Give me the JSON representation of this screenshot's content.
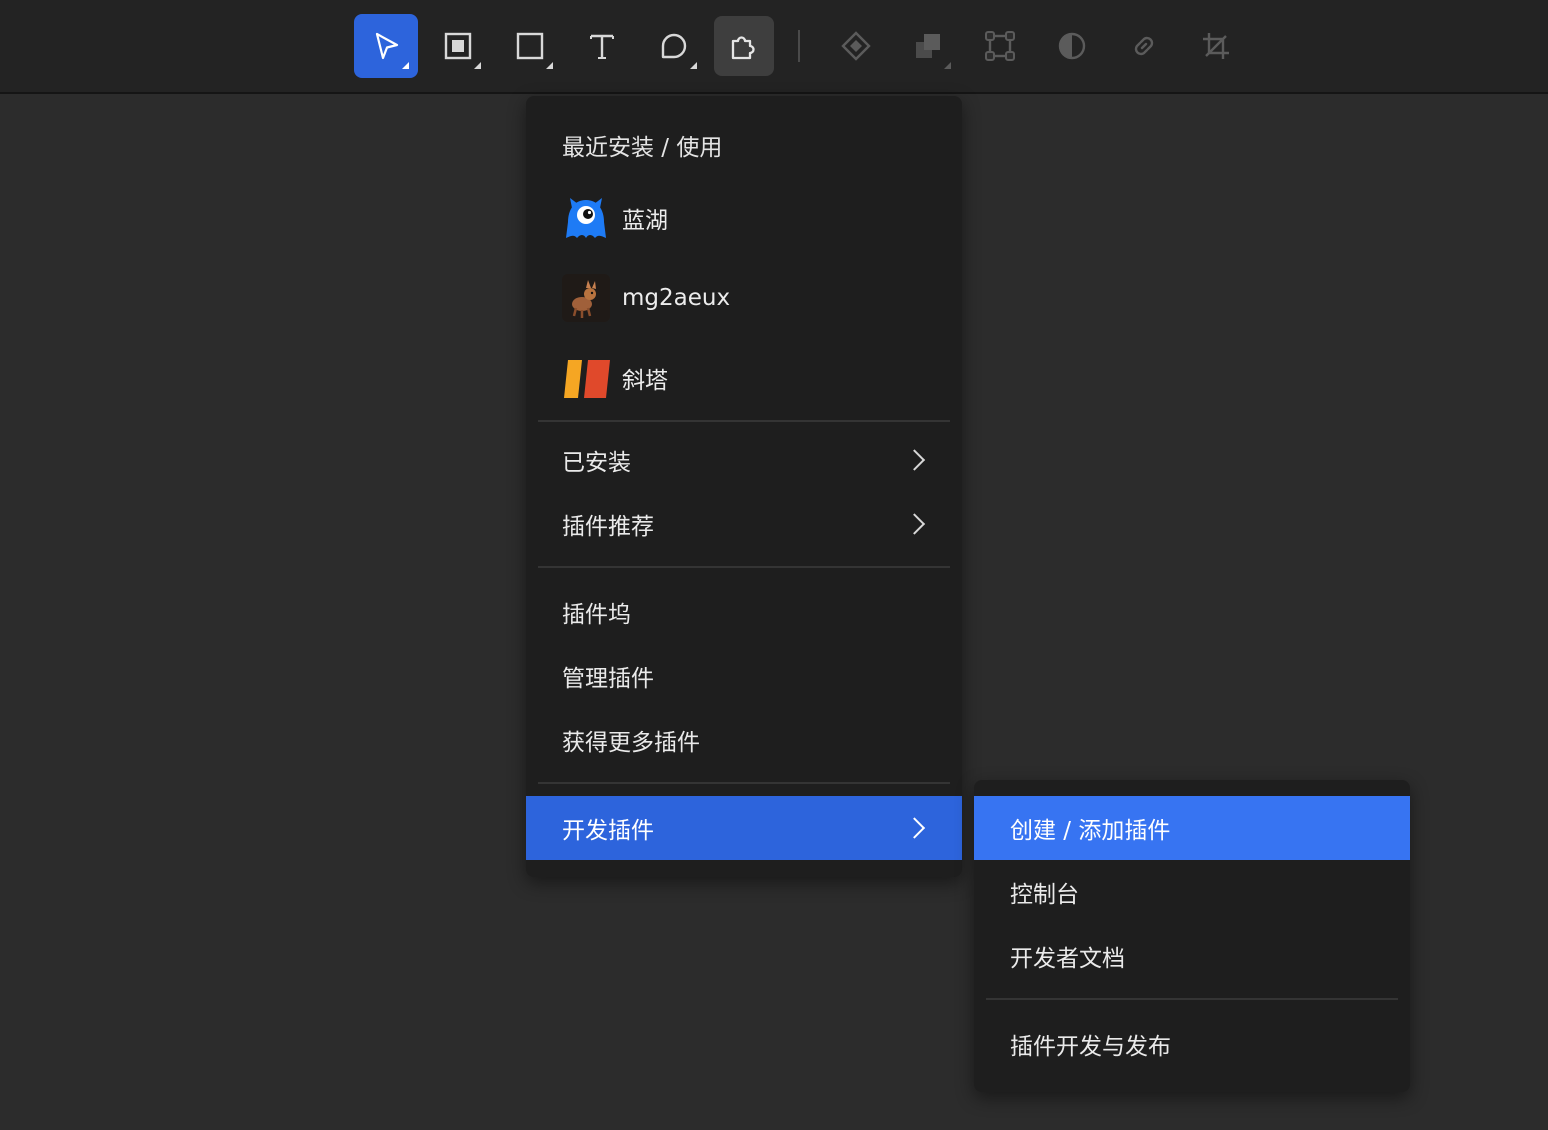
{
  "toolbar": {
    "tools": [
      {
        "name": "move-tool",
        "icon": "pointer-icon",
        "state": "active"
      },
      {
        "name": "frame-tool",
        "icon": "frame-icon",
        "state": "normal"
      },
      {
        "name": "rectangle-tool",
        "icon": "rectangle-icon",
        "state": "normal"
      },
      {
        "name": "text-tool",
        "icon": "text-icon",
        "state": "normal"
      },
      {
        "name": "comment-tool",
        "icon": "comment-icon",
        "state": "normal"
      },
      {
        "name": "plugins-tool",
        "icon": "puzzle-icon",
        "state": "open"
      },
      {
        "name": "component-tool",
        "icon": "diamond-icon",
        "state": "disabled"
      },
      {
        "name": "boolean-tool",
        "icon": "boolean-icon",
        "state": "disabled"
      },
      {
        "name": "vector-edit-tool",
        "icon": "vector-edit-icon",
        "state": "disabled"
      },
      {
        "name": "mask-tool",
        "icon": "mask-icon",
        "state": "disabled"
      },
      {
        "name": "link-tool",
        "icon": "link-icon",
        "state": "disabled"
      },
      {
        "name": "crop-tool",
        "icon": "crop-icon",
        "state": "disabled"
      }
    ]
  },
  "plugin_menu": {
    "recent_title": "最近安装 / 使用",
    "recent": [
      {
        "label": "蓝湖",
        "icon": "lanhu-logo-icon"
      },
      {
        "label": "mg2aeux",
        "icon": "mg2aeux-logo-icon"
      },
      {
        "label": "斜塔",
        "icon": "xieta-logo-icon"
      }
    ],
    "installed_label": "已安装",
    "recommended_label": "插件推荐",
    "dock_label": "插件坞",
    "manage_label": "管理插件",
    "get_more_label": "获得更多插件",
    "develop_label": "开发插件"
  },
  "develop_submenu": {
    "create_label": "创建 / 添加插件",
    "console_label": "控制台",
    "docs_label": "开发者文档",
    "publish_label": "插件开发与发布"
  },
  "colors": {
    "accent": "#2d64dc",
    "submenu_highlight": "#3774f2",
    "menu_bg": "#1e1e1e",
    "canvas_bg": "#2c2c2c"
  }
}
